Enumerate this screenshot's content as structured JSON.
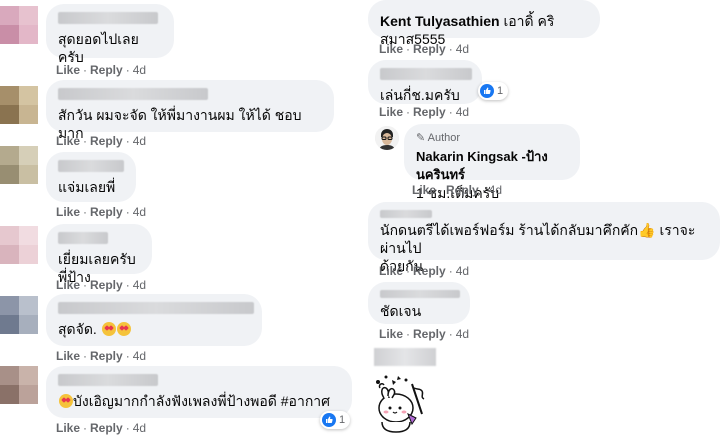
{
  "actions": {
    "like": "Like",
    "reply": "Reply",
    "separator": "·",
    "time": "4d"
  },
  "left_comments": [
    {
      "text": "สุดยอดไปเลยครับ",
      "avatar_colors": [
        "#d9a9bd",
        "#e7c2cf",
        "#c98ea7",
        "#e3b7c8"
      ]
    },
    {
      "text": "สักวัน ผมจะจัด ให้พี่มางานผม ให้ได้ ชอบมาก",
      "avatar_colors": [
        "#a68f6a",
        "#d4c4a2",
        "#8a7350",
        "#c8b592"
      ]
    },
    {
      "text": "แจ่มเลยพี่",
      "avatar_colors": [
        "#b4aa8e",
        "#d6cfb8",
        "#988e72",
        "#c9bfa3"
      ]
    },
    {
      "text": "เยี่ยมเลยครับพี่ป้าง",
      "avatar_colors": [
        "#e6c8cf",
        "#f1dce1",
        "#d9b4bd",
        "#ecd1d7"
      ]
    },
    {
      "text": "สุดจัด.",
      "avatar_colors": [
        "#8c95a8",
        "#b9c0cc",
        "#6f7a8f",
        "#a7afbd"
      ]
    },
    {
      "text": "บังเอิญมากกำลังฟังเพลงพี่ป้างพอดี #อากาศ",
      "avatar_colors": [
        "#a89088",
        "#c9b3aa",
        "#8a7168",
        "#bba29a"
      ],
      "reactions": "1"
    }
  ],
  "right_comments": [
    {
      "name": "Kent Tulyasathien",
      "text": "เอาดิ้ คริสมาส5555"
    },
    {
      "text": "เล่นกี่ช.มครับ",
      "reactions": "1"
    },
    {
      "author_tag": "Author",
      "name": "Nakarin Kingsak -ป้าง นครินทร์",
      "text": "1 ชม.เต็มครับ"
    },
    {
      "text_line1": "นักดนตรีได้เพอร์ฟอร์ม ร้านได้กลับมาคึกคัก",
      "text_line1b": " เราจะผ่านไป",
      "text_line2": "ด้วยกัน"
    },
    {
      "text": "ชัดเจน"
    }
  ],
  "icons": {
    "like": "like-thumb-icon",
    "heart_eyes": "heart-eyes-emoji-icon",
    "thumbs_up": "thumbs-up-emoji-icon",
    "sticker": "party-bunny-sticker"
  }
}
